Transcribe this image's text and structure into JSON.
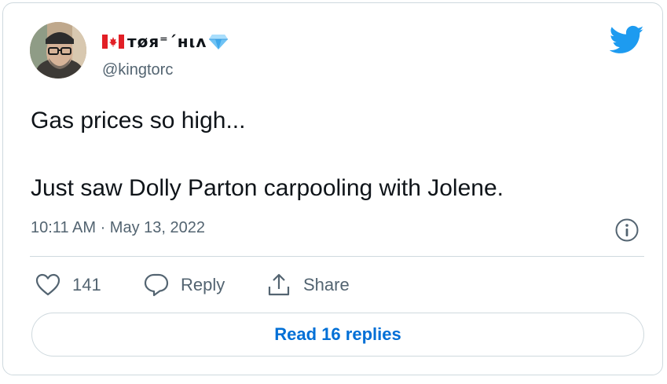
{
  "tweet": {
    "author": {
      "display_name": "тøя⁼ˊнιʌ",
      "handle": "@kingtorc",
      "flag_icon": "canada-flag-icon",
      "badge_icon": "blue-diamond-icon"
    },
    "brand_icon": "twitter-bird-icon",
    "brand_color": "#1d9bf0",
    "text": "Gas prices so high...\n\nJust saw Dolly Parton carpooling with Jolene.",
    "timestamp": "10:11 AM · May 13, 2022",
    "actions": {
      "like_count": "141",
      "reply_label": "Reply",
      "share_label": "Share"
    },
    "read_replies_label": "Read 16 replies",
    "link_color": "#006fd6"
  }
}
